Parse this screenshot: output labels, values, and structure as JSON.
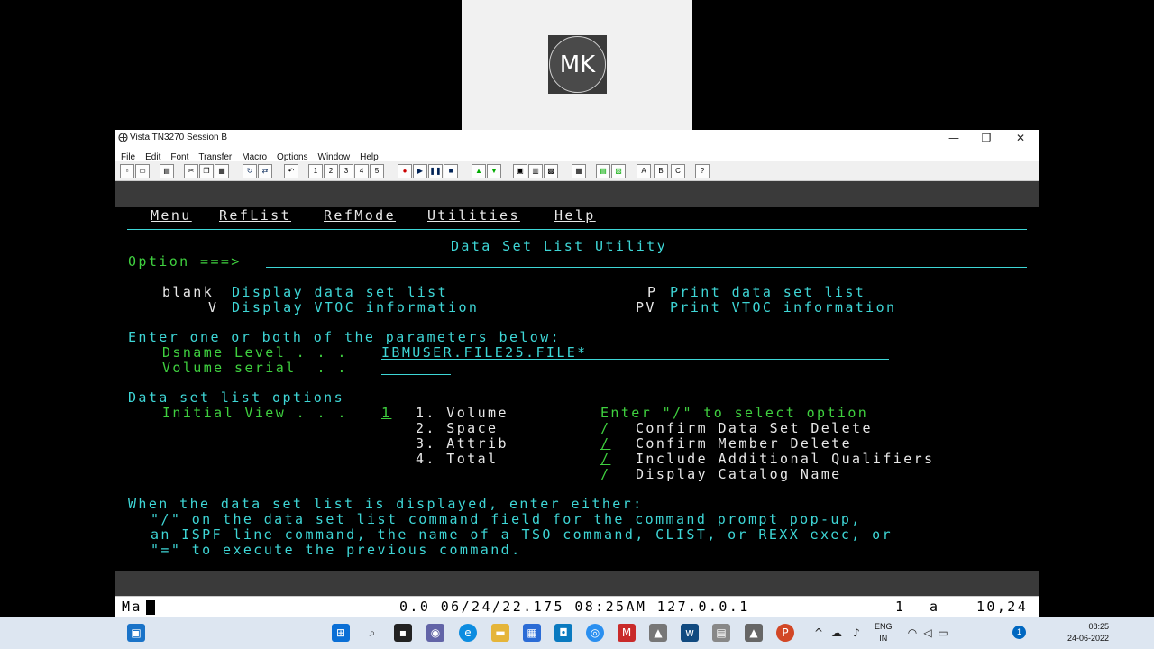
{
  "camera": {
    "initials": "MK"
  },
  "window": {
    "title": "Vista TN3270 Session B",
    "controls": {
      "minimize": "—",
      "restore": "❐",
      "close": "✕"
    },
    "menu": [
      "File",
      "Edit",
      "Font",
      "Transfer",
      "Macro",
      "Options",
      "Window",
      "Help"
    ],
    "toolbar_letters": [
      "A",
      "B",
      "C",
      "?"
    ]
  },
  "ispf": {
    "actionbar": [
      "Menu",
      "RefList",
      "RefMode",
      "Utilities",
      "Help"
    ],
    "title": "Data Set List Utility",
    "option_label": "Option ===>",
    "option_value": "",
    "options": [
      {
        "key": "blank",
        "desc": "Display data set list"
      },
      {
        "key": "V",
        "desc": "Display VTOC information"
      },
      {
        "key": "P",
        "desc": "Print data set list"
      },
      {
        "key": "PV",
        "desc": "Print VTOC information"
      }
    ],
    "params_heading": "Enter one or both of the parameters below:",
    "dsname_label": "Dsname Level . . .",
    "dsname_value": "IBMUSER.FILE25.FILE*",
    "volume_label": "Volume serial  . .",
    "volume_value": "",
    "list_options_heading": "Data set list options",
    "initial_view_label": "Initial View . . .",
    "initial_view_value": "1",
    "views": [
      "1. Volume",
      "2. Space",
      "3. Attrib",
      "4. Total"
    ],
    "select_hint": "Enter \"/\" to select option",
    "checks": [
      {
        "mark": "/",
        "label": "Confirm Data Set Delete"
      },
      {
        "mark": "/",
        "label": "Confirm Member Delete"
      },
      {
        "mark": "/",
        "label": "Include Additional Qualifiers"
      },
      {
        "mark": "/",
        "label": "Display Catalog Name"
      }
    ],
    "help_lines": [
      "When the data set list is displayed, enter either:",
      "\"/\" on the data set list command field for the command prompt pop-up,",
      "an ISPF line command, the name of a TSO command, CLIST, or REXX exec, or",
      "\"=\" to execute the previous command."
    ]
  },
  "statusbar": {
    "left": "Ma",
    "center": "0.0 06/24/22.175 08:25AM 127.0.0.1",
    "session": "1",
    "mode": "a",
    "cursor": "10,24"
  },
  "taskbar": {
    "lang_top": "ENG",
    "lang_bottom": "IN",
    "time": "08:25",
    "date": "24-06-2022",
    "notifications": "1"
  }
}
